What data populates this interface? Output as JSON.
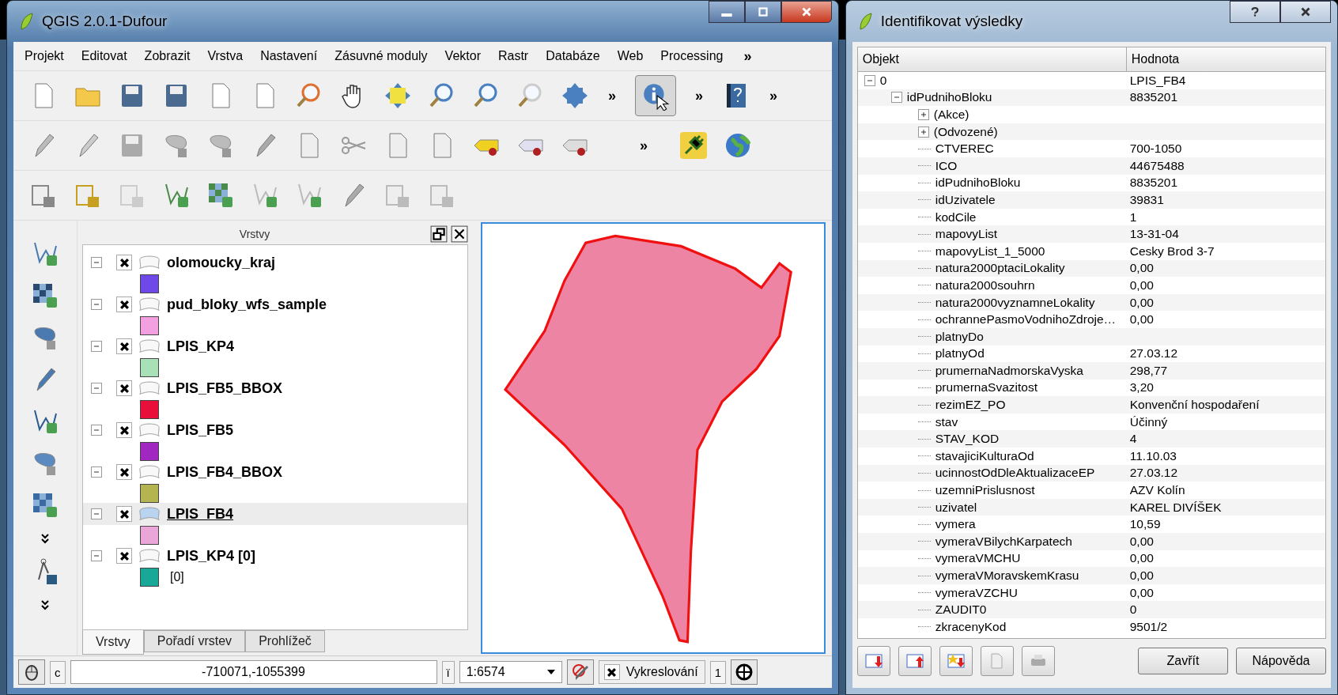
{
  "main_window": {
    "title": "QGIS 2.0.1-Dufour"
  },
  "menu": [
    "Projekt",
    "Editovat",
    "Zobrazit",
    "Vrstva",
    "Nastavení",
    "Zásuvné moduly",
    "Vektor",
    "Rastr",
    "Databáze",
    "Web",
    "Processing"
  ],
  "menu_overflow": "»",
  "toolbar_overflow": {
    "row1": [
      "»",
      "»",
      "»"
    ],
    "row2": [
      "»"
    ]
  },
  "layers_panel": {
    "title": "Vrstvy",
    "layers": [
      {
        "name": "olomoucky_kraj",
        "expanded": true,
        "checked": true,
        "selected": false,
        "color": "#6f48e8"
      },
      {
        "name": "pud_bloky_wfs_sample",
        "expanded": true,
        "checked": true,
        "selected": false,
        "color": "#f2a0e0"
      },
      {
        "name": "LPIS_KP4",
        "expanded": true,
        "checked": true,
        "selected": false,
        "color": "#a8e0b8"
      },
      {
        "name": "LPIS_FB5_BBOX",
        "expanded": true,
        "checked": true,
        "selected": false,
        "color": "#e8103a"
      },
      {
        "name": "LPIS_FB5",
        "expanded": true,
        "checked": true,
        "selected": false,
        "color": "#a028c0"
      },
      {
        "name": "LPIS_FB4_BBOX",
        "expanded": true,
        "checked": true,
        "selected": false,
        "color": "#b4b450"
      },
      {
        "name": "LPIS_FB4",
        "expanded": true,
        "checked": true,
        "selected": true,
        "color": "#eaa6d8"
      },
      {
        "name": "LPIS_KP4 [0]",
        "expanded": true,
        "checked": true,
        "selected": false,
        "color": "#18a898",
        "class_label": "[0]"
      }
    ],
    "tabs": [
      {
        "label": "Vrstvy",
        "selected": true
      },
      {
        "label": "Pořadí vrstev",
        "selected": false
      },
      {
        "label": "Prohlížeč",
        "selected": false
      }
    ]
  },
  "status_bar": {
    "coord_label": "c",
    "coordinates": "-710071,-1055399",
    "scale_label": "ï",
    "scale": "1:6574",
    "render_checked": true,
    "render_label": "Vykreslování",
    "rotation": "1"
  },
  "identify": {
    "title": "Identifikovat výsledky",
    "columns": [
      "Objekt",
      "Hodnota"
    ],
    "tree": [
      {
        "name": "0",
        "value": "LPIS_FB4",
        "expanded": true,
        "children": [
          {
            "name": "idPudnihoBloku",
            "value": "8835201",
            "expanded": true,
            "children": [
              {
                "name": "(Akce)",
                "expanded": false
              },
              {
                "name": "(Odvozené)",
                "expanded": false
              },
              {
                "name": "CTVEREC",
                "value": "700-1050"
              },
              {
                "name": "ICO",
                "value": "44675488"
              },
              {
                "name": "idPudnihoBloku",
                "value": "8835201"
              },
              {
                "name": "idUzivatele",
                "value": "39831"
              },
              {
                "name": "kodCile",
                "value": "1"
              },
              {
                "name": "mapovyList",
                "value": "13-31-04"
              },
              {
                "name": "mapovyList_1_5000",
                "value": "Cesky Brod 3-7"
              },
              {
                "name": "natura2000ptaciLokality",
                "value": "0,00"
              },
              {
                "name": "natura2000souhrn",
                "value": "0,00"
              },
              {
                "name": "natura2000vyznamneLokality",
                "value": "0,00"
              },
              {
                "name": "ochrannePasmoVodnihoZdroje…",
                "value": "0,00"
              },
              {
                "name": "platnyDo"
              },
              {
                "name": "platnyOd",
                "value": "27.03.12"
              },
              {
                "name": "prumernaNadmorskaVyska",
                "value": "298,77"
              },
              {
                "name": "prumernaSvazitost",
                "value": "3,20"
              },
              {
                "name": "rezimEZ_PO",
                "value": "Konvenční hospodaření"
              },
              {
                "name": "stav",
                "value": "Účinný"
              },
              {
                "name": "STAV_KOD",
                "value": "4"
              },
              {
                "name": "stavajiciKulturaOd",
                "value": "11.10.03"
              },
              {
                "name": "ucinnostOdDleAktualizaceEP",
                "value": "27.03.12"
              },
              {
                "name": "uzemniPrislusnost",
                "value": "AZV Kolín"
              },
              {
                "name": "uzivatel",
                "value": "KAREL DIVÍŠEK"
              },
              {
                "name": "vymera",
                "value": "10,59"
              },
              {
                "name": "vymeraVBilychKarpatech",
                "value": "0,00"
              },
              {
                "name": "vymeraVMCHU",
                "value": "0,00"
              },
              {
                "name": "vymeraVMoravskemKrasu",
                "value": "0,00"
              },
              {
                "name": "vymeraVZCHU",
                "value": "0,00"
              },
              {
                "name": "ZAUDIT0",
                "value": "0"
              },
              {
                "name": "zkracenyKod",
                "value": "9501/2"
              }
            ]
          }
        ]
      }
    ],
    "buttons": [
      "Zavřít",
      "Nápověda"
    ]
  }
}
